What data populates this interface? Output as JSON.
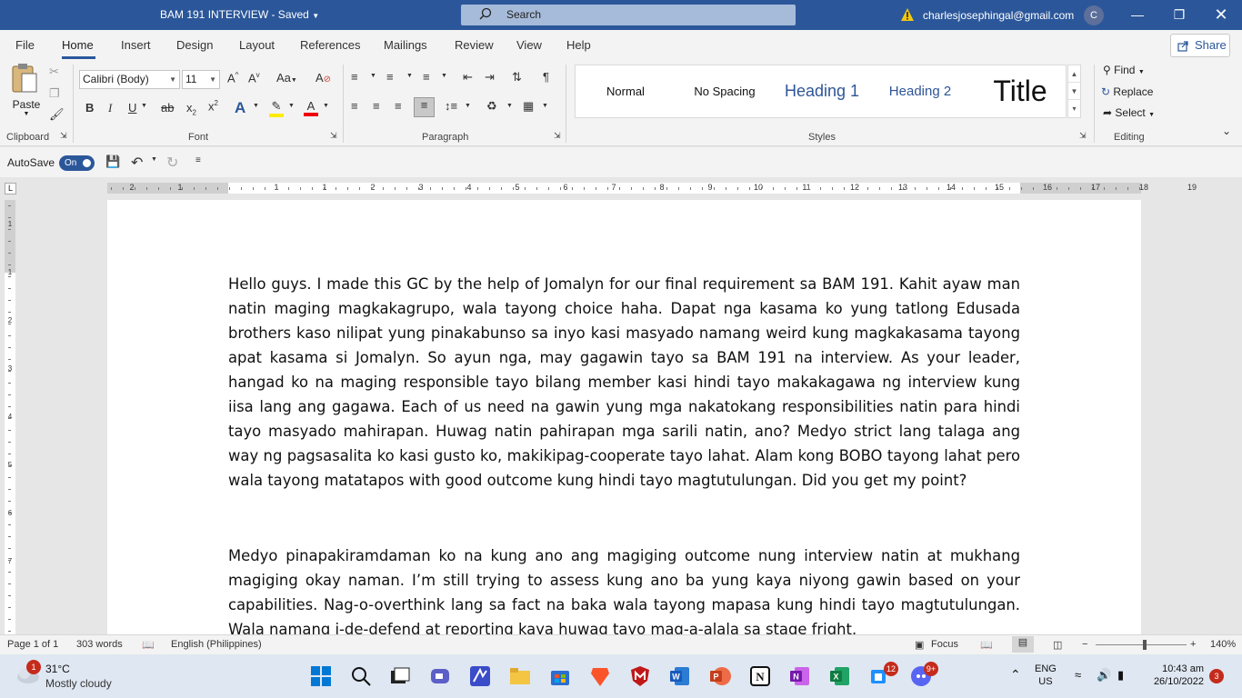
{
  "titlebar": {
    "doc_title": "BAM 191 INTERVIEW  -  Saved",
    "search_label": "Search",
    "email": "charlesjosephingal@gmail.com",
    "avatar_initial": "C"
  },
  "menu": {
    "tabs": [
      "File",
      "Home",
      "Insert",
      "Design",
      "Layout",
      "References",
      "Mailings",
      "Review",
      "View",
      "Help"
    ],
    "share_label": "Share"
  },
  "ribbon": {
    "clipboard": {
      "paste_label": "Paste",
      "group_label": "Clipboard"
    },
    "font": {
      "font_name": "Calibri (Body)",
      "font_size": "11",
      "group_label": "Font"
    },
    "paragraph": {
      "group_label": "Paragraph"
    },
    "styles": {
      "items": [
        "Normal",
        "No Spacing",
        "Heading 1",
        "Heading 2",
        "Title"
      ],
      "group_label": "Styles"
    },
    "editing": {
      "find_label": "Find",
      "replace_label": "Replace",
      "select_label": "Select",
      "group_label": "Editing"
    }
  },
  "qat": {
    "autosave_label": "AutoSave",
    "toggle_label": "On"
  },
  "ruler": {
    "horizontal_labels": [
      "2",
      "1",
      "1",
      "1",
      "2",
      "3",
      "4",
      "5",
      "6",
      "7",
      "8",
      "9",
      "10",
      "11",
      "12",
      "13",
      "14",
      "15",
      "16",
      "17",
      "18",
      "19"
    ],
    "vertical_labels": [
      "1",
      "1",
      "2",
      "3",
      "4",
      "5",
      "6",
      "7"
    ],
    "corner": "L"
  },
  "document": {
    "paragraphs": [
      "Hello guys. I made this GC by the help of Jomalyn for our final requirement sa BAM 191. Kahit ayaw man natin maging magkakagrupo, wala tayong choice haha. Dapat nga kasama ko yung tatlong Edusada brothers kaso nilipat yung pinakabunso sa inyo kasi masyado namang weird kung magkakasama tayong apat kasama si Jomalyn. So ayun nga, may gagawin tayo sa BAM 191 na interview. As your leader, hangad ko na maging responsible tayo bilang member kasi hindi tayo makakagawa ng interview kung iisa lang ang gagawa. Each of us need na gawin yung mga nakatokang responsibilities natin para hindi tayo masyado mahirapan. Huwag natin pahirapan mga sarili natin, ano? Medyo strict lang talaga ang way ng pagsasalita ko kasi gusto ko, makikipag-cooperate tayo lahat. Alam kong BOBO tayong lahat pero wala tayong matatapos with good outcome kung hindi tayo magtutulungan. Did you get my point?",
      "Medyo pinapakiramdaman ko na kung ano ang magiging outcome nung interview natin at mukhang magiging okay naman. I’m still trying to assess kung ano ba yung kaya niyong gawin based on your capabilities. Nag-o-overthink lang sa fact na baka wala tayong mapasa kung hindi tayo magtutulungan. Wala namang i-de-defend at reporting kaya huwag tayo mag-a-alala sa stage fright."
    ]
  },
  "status": {
    "page": "Page 1 of 1",
    "words": "303 words",
    "language": "English (Philippines)",
    "focus": "Focus",
    "zoom": "140%"
  },
  "taskbar": {
    "weather_temp": "31°C",
    "weather_desc": "Mostly cloudy",
    "weather_badge": "1",
    "teams_badge": "12",
    "discord_badge": "9+",
    "lang_top": "ENG",
    "lang_bottom": "US",
    "time": "10:43 am",
    "date": "26/10/2022",
    "notif_count": "3"
  },
  "colors": {
    "accent": "#2b579a",
    "titlebar": "#2b579a",
    "heading_blue": "#2f5597"
  }
}
